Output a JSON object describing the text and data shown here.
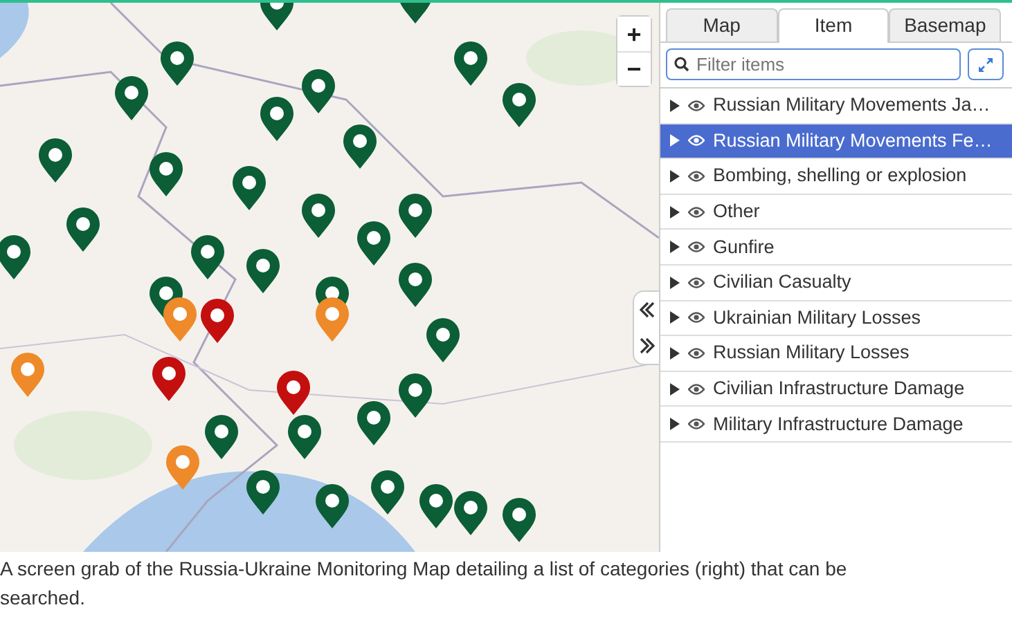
{
  "map": {
    "kind": "picture",
    "zoom_buttons": [
      "+",
      "−"
    ]
  },
  "panel": {
    "tabs": [
      {
        "label": "Map",
        "selected": false
      },
      {
        "label": "Item",
        "selected": true
      },
      {
        "label": "Basemap",
        "selected": false
      }
    ],
    "filter": {
      "placeholder": "Filter items"
    },
    "items": [
      {
        "label": "Russian Military Movements Ja…",
        "selected": false
      },
      {
        "label": "Russian Military Movements Fe…",
        "selected": true
      },
      {
        "label": "Bombing, shelling or explosion",
        "selected": false
      },
      {
        "label": "Other",
        "selected": false
      },
      {
        "label": "Gunfire",
        "selected": false
      },
      {
        "label": "Civilian Casualty",
        "selected": false
      },
      {
        "label": "Ukrainian Military Losses",
        "selected": false
      },
      {
        "label": "Russian Military Losses",
        "selected": false
      },
      {
        "label": "Civilian Infrastructure Damage",
        "selected": false
      },
      {
        "label": "Military Infrastructure Damage",
        "selected": false
      }
    ]
  },
  "caption": "A screen grab of the Russia-Ukraine Monitoring Map detailing a list of categories (right) that can be searched."
}
